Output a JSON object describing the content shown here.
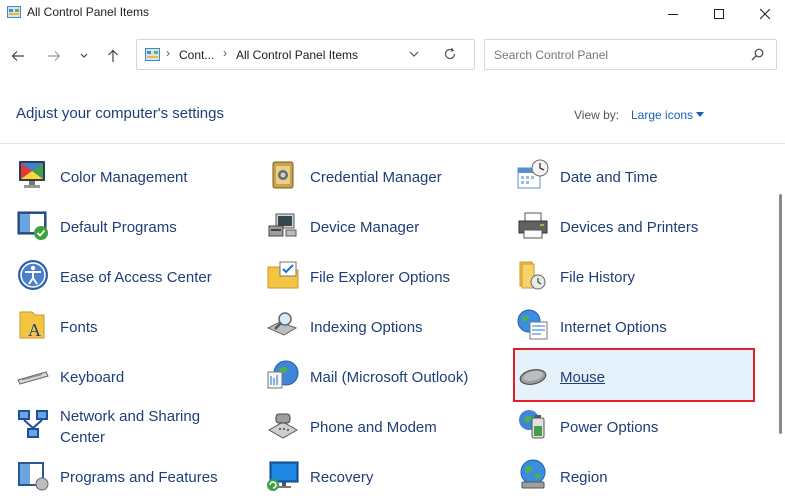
{
  "window": {
    "title": "All Control Panel Items"
  },
  "address": {
    "crumb_short": "Cont...",
    "crumb_current": "All Control Panel Items"
  },
  "search": {
    "placeholder": "Search Control Panel"
  },
  "header": {
    "heading": "Adjust your computer's settings",
    "view_by_label": "View by:",
    "view_by_value": "Large icons"
  },
  "items": [
    {
      "label": "Color Management",
      "icon": "color-management-icon"
    },
    {
      "label": "Credential Manager",
      "icon": "credential-manager-icon"
    },
    {
      "label": "Date and Time",
      "icon": "date-time-icon"
    },
    {
      "label": "Default Programs",
      "icon": "default-programs-icon"
    },
    {
      "label": "Device Manager",
      "icon": "device-manager-icon"
    },
    {
      "label": "Devices and Printers",
      "icon": "printer-icon"
    },
    {
      "label": "Ease of Access Center",
      "icon": "ease-of-access-icon"
    },
    {
      "label": "File Explorer Options",
      "icon": "folder-options-icon"
    },
    {
      "label": "File History",
      "icon": "file-history-icon"
    },
    {
      "label": "Fonts",
      "icon": "fonts-icon"
    },
    {
      "label": "Indexing Options",
      "icon": "indexing-icon"
    },
    {
      "label": "Internet Options",
      "icon": "internet-options-icon"
    },
    {
      "label": "Keyboard",
      "icon": "keyboard-icon"
    },
    {
      "label": "Mail (Microsoft Outlook)",
      "icon": "mail-icon"
    },
    {
      "label": "Mouse",
      "icon": "mouse-icon"
    },
    {
      "label": "Network and Sharing Center",
      "icon": "network-icon"
    },
    {
      "label": "Phone and Modem",
      "icon": "phone-icon"
    },
    {
      "label": "Power Options",
      "icon": "power-options-icon"
    },
    {
      "label": "Programs and Features",
      "icon": "programs-features-icon"
    },
    {
      "label": "Recovery",
      "icon": "recovery-icon"
    },
    {
      "label": "Region",
      "icon": "region-icon"
    }
  ],
  "colors": {
    "link": "#1e3e78",
    "highlight": "#e5f1fb",
    "selection_border": "#e01f26"
  }
}
